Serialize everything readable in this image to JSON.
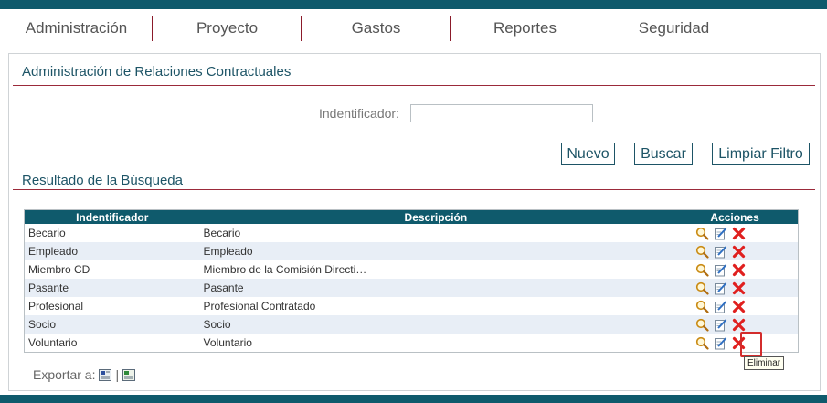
{
  "nav": {
    "items": [
      {
        "label": "Administración"
      },
      {
        "label": "Proyecto"
      },
      {
        "label": "Gastos"
      },
      {
        "label": "Reportes"
      },
      {
        "label": "Seguridad"
      }
    ]
  },
  "page": {
    "title": "Administración de Relaciones Contractuales",
    "results_title": "Resultado de la Búsqueda"
  },
  "filter": {
    "label": "Indentificador:",
    "value": "",
    "placeholder": ""
  },
  "buttons": {
    "new": "Nuevo",
    "search": "Buscar",
    "clear": "Limpiar Filtro"
  },
  "table": {
    "headers": {
      "id": "Indentificador",
      "desc": "Descripción",
      "actions": "Acciones"
    },
    "rows": [
      {
        "id": "Becario",
        "desc": "Becario"
      },
      {
        "id": "Empleado",
        "desc": "Empleado"
      },
      {
        "id": "Miembro CD",
        "desc": "Miembro de la Comisión Directi…"
      },
      {
        "id": "Pasante",
        "desc": "Pasante"
      },
      {
        "id": "Profesional",
        "desc": "Profesional Contratado"
      },
      {
        "id": "Socio",
        "desc": "Socio"
      },
      {
        "id": "Voluntario",
        "desc": "Voluntario"
      }
    ],
    "action_icons": [
      "magnifier-icon",
      "edit-icon",
      "delete-icon"
    ]
  },
  "export": {
    "label": "Exportar a:",
    "separator": "|"
  },
  "tooltip": {
    "text": "Eliminar"
  },
  "colors": {
    "brand": "#0f5a6c",
    "accent": "#9b2a3a",
    "delete": "#e0201f",
    "row_alt": "#e8eef6"
  }
}
